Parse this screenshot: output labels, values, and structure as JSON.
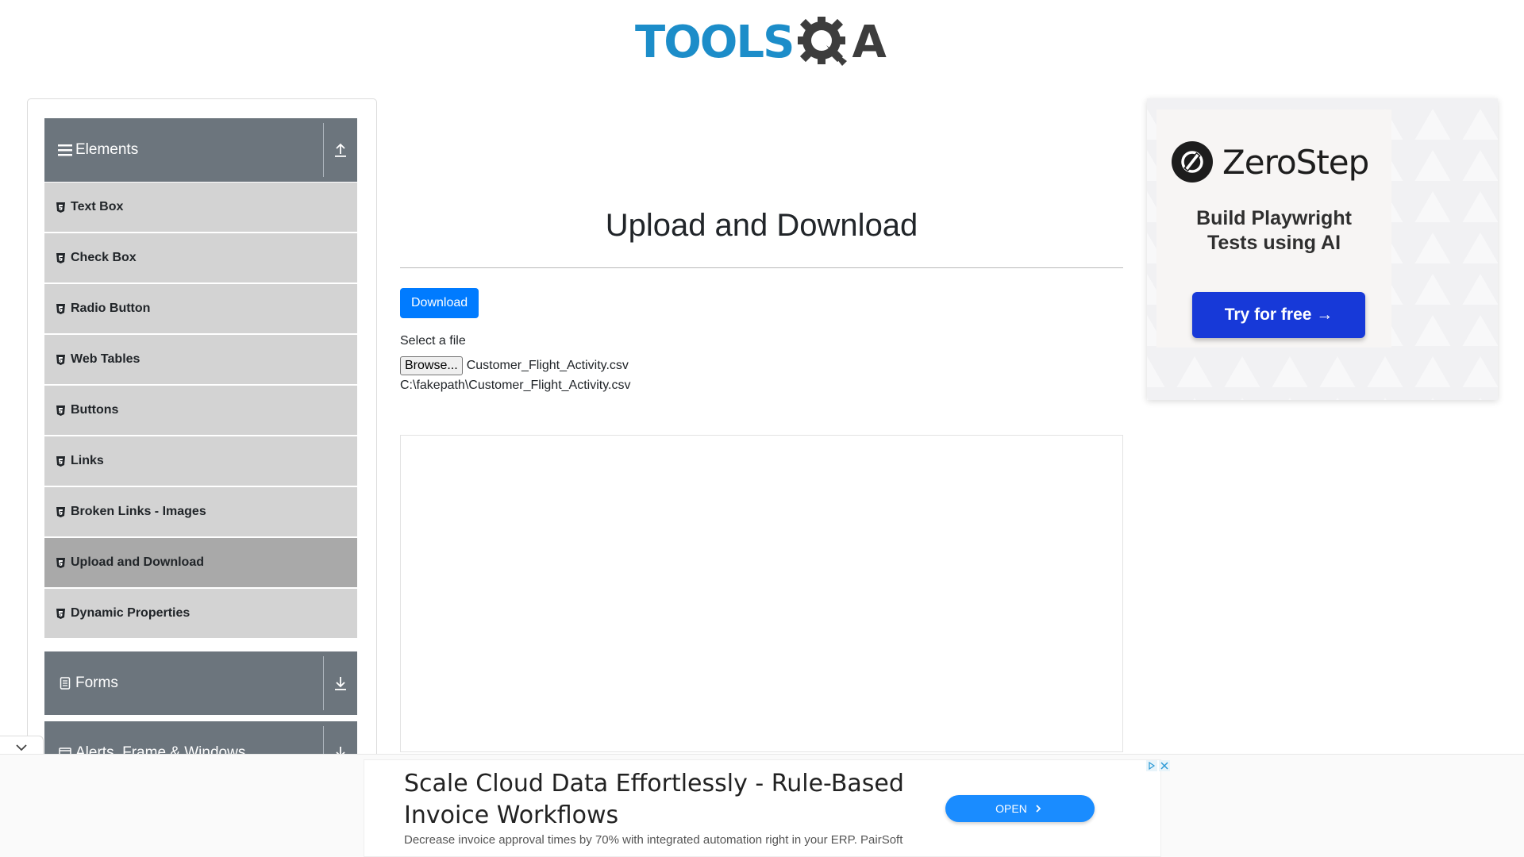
{
  "header": {
    "logo_tools": "TOOLS",
    "logo_qa": "A"
  },
  "sidebar": {
    "groups": [
      {
        "label": "Elements",
        "toggle_icon": "arrow-up-icon"
      },
      {
        "label": "Forms",
        "toggle_icon": "arrow-down-icon"
      },
      {
        "label": "Alerts, Frame & Windows",
        "toggle_icon": "arrow-down-icon"
      }
    ],
    "items": [
      {
        "label": "Text Box"
      },
      {
        "label": "Check Box"
      },
      {
        "label": "Radio Button"
      },
      {
        "label": "Web Tables"
      },
      {
        "label": "Buttons"
      },
      {
        "label": "Links"
      },
      {
        "label": "Broken Links - Images"
      },
      {
        "label": "Upload and Download",
        "active": true
      },
      {
        "label": "Dynamic Properties"
      }
    ]
  },
  "main": {
    "title": "Upload and Download",
    "download_label": "Download",
    "select_label": "Select a file",
    "browse_label": "Browse...",
    "file_name": "Customer_Flight_Activity.csv",
    "file_path": "C:\\fakepath\\Customer_Flight_Activity.csv"
  },
  "ad_right": {
    "brand": "ZeroStep",
    "tagline_line1": "Build Playwright",
    "tagline_line2": "Tests using AI",
    "cta": "Try for free →"
  },
  "bottom_ad": {
    "title": "Scale Cloud Data Effortlessly - Rule-Based Invoice Workflows",
    "description": "Decrease invoice approval times by 70% with integrated automation right in your ERP. PairSoft",
    "open_label": "OPEN"
  },
  "colors": {
    "accent": "#007bff",
    "sidebar_header": "#6c757d",
    "menu_item": "#d3d3d3",
    "menu_item_active": "#a9a9a9",
    "logo_blue": "#1c8dc9",
    "cta_blue": "#1739d8"
  }
}
